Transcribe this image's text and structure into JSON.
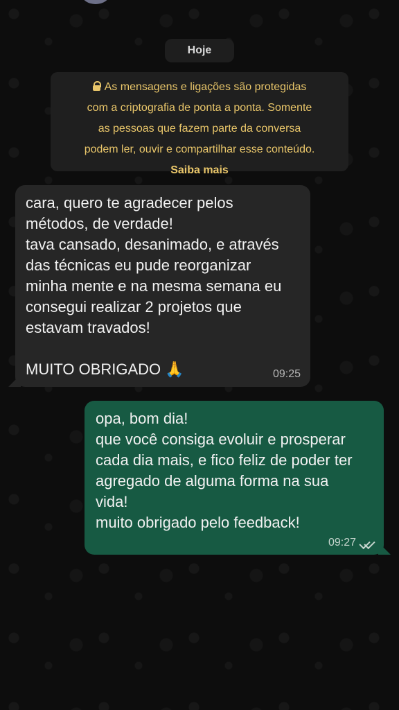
{
  "conversation": {
    "date_chip": "Hoje",
    "security_notice": {
      "lines": [
        "As mensagens e ligações são protegidas",
        "com a criptografia de ponta a ponta. Somente",
        "as pessoas que fazem parte da conversa",
        "podem ler, ouvir e compartilhar esse conteúdo."
      ],
      "link": "Saiba mais",
      "icon": "lock-icon"
    },
    "messages": [
      {
        "direction": "incoming",
        "lines": [
          "cara, quero te agradecer pelos",
          "métodos, de verdade!",
          "tava cansado, desanimado, e através",
          "das técnicas eu pude reorganizar",
          "minha mente e na mesma semana eu",
          "consegui realizar 2 projetos que",
          "estavam travados!",
          "",
          "MUITO OBRIGADO 🙏"
        ],
        "time": "09:25"
      },
      {
        "direction": "outgoing",
        "lines": [
          "opa, bom dia!",
          "que você consiga evoluir e prosperar",
          "cada dia mais, e fico feliz de poder ter",
          "agregado de alguma forma na sua",
          "vida!",
          "muito obrigado pelo feedback!"
        ],
        "time": "09:27",
        "status_icon": "double-check-icon"
      }
    ]
  },
  "colors": {
    "background": "#0d0d0d",
    "incoming_bubble": "#262626",
    "outgoing_bubble": "#175a43",
    "notice_text": "#e9c66a"
  }
}
